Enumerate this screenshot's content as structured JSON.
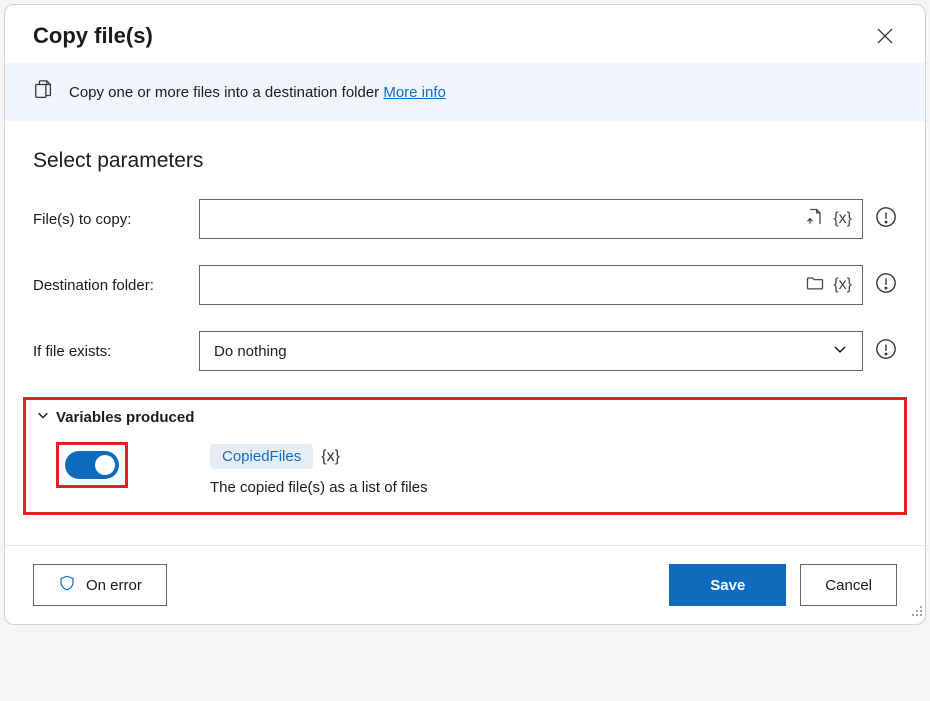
{
  "dialog": {
    "title": "Copy file(s)",
    "banner": {
      "text": "Copy one or more files into a destination folder ",
      "link": "More info"
    },
    "section_title": "Select parameters",
    "fields": {
      "files_label": "File(s) to copy:",
      "files_value": "",
      "dest_label": "Destination folder:",
      "dest_value": "",
      "exists_label": "If file exists:",
      "exists_value": "Do nothing"
    },
    "variables": {
      "header": "Variables produced",
      "name": "CopiedFiles",
      "brace": "{x}",
      "description": "The copied file(s) as a list of files"
    },
    "footer": {
      "on_error": "On error",
      "save": "Save",
      "cancel": "Cancel"
    }
  }
}
